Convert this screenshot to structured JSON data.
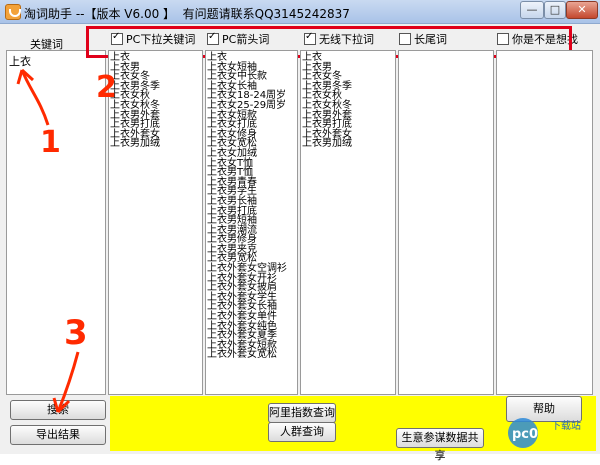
{
  "window": {
    "title": "淘词助手 --【版本 V6.00 】  有问题请联系QQ3145242837",
    "min": "—",
    "max": "□",
    "close": "✕"
  },
  "keyword": {
    "label": "关键词",
    "value": "上衣"
  },
  "columns": [
    {
      "label": "PC下拉关键词",
      "checked": true
    },
    {
      "label": "PC箭头词",
      "checked": true
    },
    {
      "label": "无线下拉词",
      "checked": true
    },
    {
      "label": "长尾词",
      "checked": false
    },
    {
      "label": "你是不是想找",
      "checked": false
    }
  ],
  "lists": {
    "pc_dropdown": [
      "上衣",
      "上衣男",
      "上衣女冬",
      "上衣男冬季",
      "上衣女秋",
      "上衣女秋冬",
      "上衣男外套",
      "上衣男打底",
      "上衣外套女",
      "上衣男加绒"
    ],
    "pc_arrow": [
      "上衣",
      "上衣女短袖",
      "上衣女中长款",
      "上衣女长袖",
      "上衣女18-24周岁",
      "上衣女25-29周岁",
      "上衣女短款",
      "上衣女打底",
      "上衣女修身",
      "上衣女宽松",
      "上衣女加绒",
      "上衣女T恤",
      "上衣男T恤",
      "上衣男青春",
      "上衣男学生",
      "上衣男长袖",
      "上衣男打底",
      "上衣男短袖",
      "上衣男潮流",
      "上衣男修身",
      "上衣男夹克",
      "上衣男宽松",
      "上衣外套女空调衫",
      "上衣外套女开衫",
      "上衣外套女披肩",
      "上衣外套女学生",
      "上衣外套女长袖",
      "上衣外套女单件",
      "上衣外套女纯色",
      "上衣外套女夏季",
      "上衣外套女短款",
      "上衣外套女宽松"
    ],
    "mobile_dropdown": [
      "上衣",
      "上衣男",
      "上衣女冬",
      "上衣男冬季",
      "上衣女秋",
      "上衣女秋冬",
      "上衣男外套",
      "上衣男打底",
      "上衣外套女",
      "上衣男加绒"
    ],
    "long_tail": [],
    "did_you_mean": []
  },
  "buttons": {
    "search": "搜索",
    "export": "导出结果",
    "ali_index": "阿里指数查询",
    "crowd": "人群查询",
    "share": "生意参谋数据共享",
    "help": "帮助"
  },
  "annotations": {
    "one": "1",
    "two": "2",
    "three": "3"
  },
  "watermark": {
    "text": "下载站",
    "logo": "pc0"
  },
  "colors": {
    "highlight_box": "#e0001a",
    "bottom_panel": "#ffff00",
    "annotation": "#ff2a00"
  }
}
